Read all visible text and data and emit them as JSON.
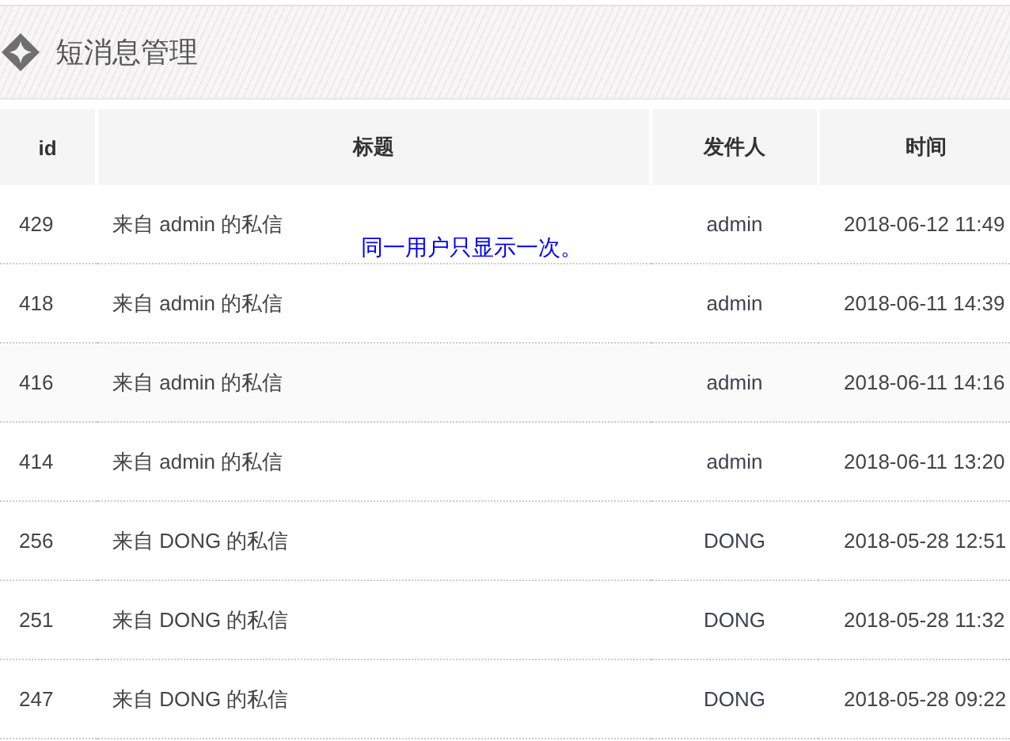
{
  "page": {
    "title": "短消息管理"
  },
  "table": {
    "columns": [
      "id",
      "标题",
      "发件人",
      "时间"
    ],
    "rows": [
      {
        "id": "429",
        "title": "来自 admin 的私信",
        "sender": "admin",
        "time": "2018-06-12 11:49"
      },
      {
        "id": "418",
        "title": "来自 admin 的私信",
        "sender": "admin",
        "time": "2018-06-11 14:39"
      },
      {
        "id": "416",
        "title": "来自 admin 的私信",
        "sender": "admin",
        "time": "2018-06-11 14:16"
      },
      {
        "id": "414",
        "title": "来自 admin 的私信",
        "sender": "admin",
        "time": "2018-06-11 13:20"
      },
      {
        "id": "256",
        "title": "来自 DONG 的私信",
        "sender": "DONG",
        "time": "2018-05-28 12:51"
      },
      {
        "id": "251",
        "title": "来自 DONG 的私信",
        "sender": "DONG",
        "time": "2018-05-28 11:32"
      },
      {
        "id": "247",
        "title": "来自 DONG 的私信",
        "sender": "DONG",
        "time": "2018-05-28 09:22"
      }
    ]
  },
  "tooltip": {
    "text": "同一用户只显示一次。"
  }
}
